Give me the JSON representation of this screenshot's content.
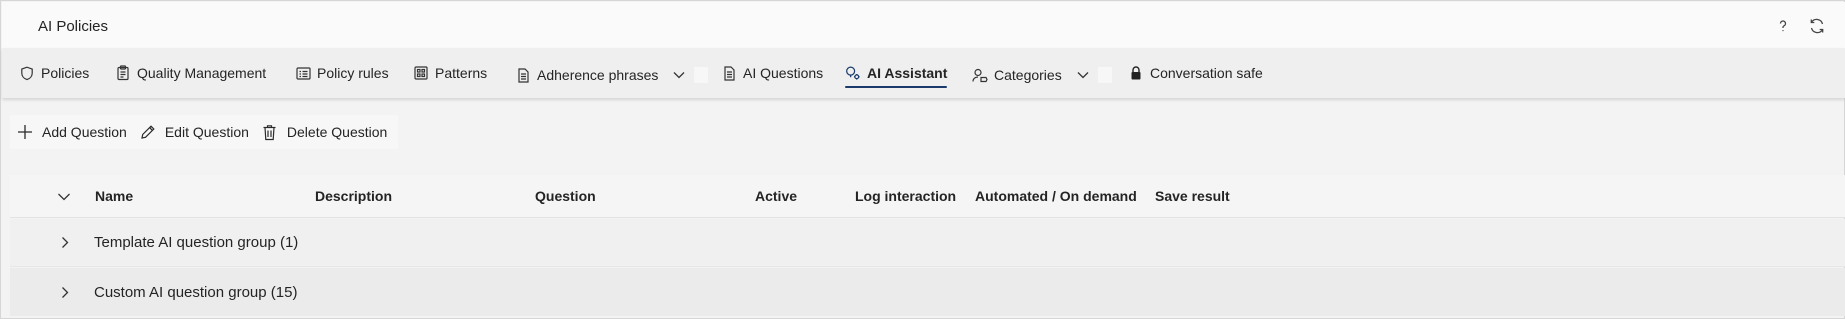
{
  "app": {
    "title": "AI Policies"
  },
  "title_actions": {
    "help_icon": "help-icon",
    "refresh_icon": "refresh-icon"
  },
  "tabs": [
    {
      "label": "Policies",
      "icon": "shield-icon"
    },
    {
      "label": "Quality Management",
      "icon": "clipboard-icon"
    },
    {
      "label": "Policy rules",
      "icon": "list-card-icon"
    },
    {
      "label": "Patterns",
      "icon": "pattern-grid-icon"
    },
    {
      "label": "Adherence phrases",
      "icon": "document-icon",
      "dropdown": true
    },
    {
      "label": "AI Questions",
      "icon": "document-icon"
    },
    {
      "label": "AI Assistant",
      "icon": "people-sparkle-icon",
      "active": true
    },
    {
      "label": "Categories",
      "icon": "person-tag-icon",
      "dropdown": true
    },
    {
      "label": "Conversation safe",
      "icon": "lock-icon"
    }
  ],
  "commands": {
    "add": "Add Question",
    "edit": "Edit Question",
    "delete": "Delete Question"
  },
  "grid": {
    "columns": [
      "Name",
      "Description",
      "Question",
      "Active",
      "Log interaction",
      "Automated / On demand",
      "Save result"
    ],
    "groups": [
      {
        "label": "Template AI question group (1)"
      },
      {
        "label": "Custom AI question group (15)"
      }
    ]
  },
  "colors": {
    "accent": "#1b3a6b",
    "text": "#242424",
    "background": "#f3f3f3"
  }
}
